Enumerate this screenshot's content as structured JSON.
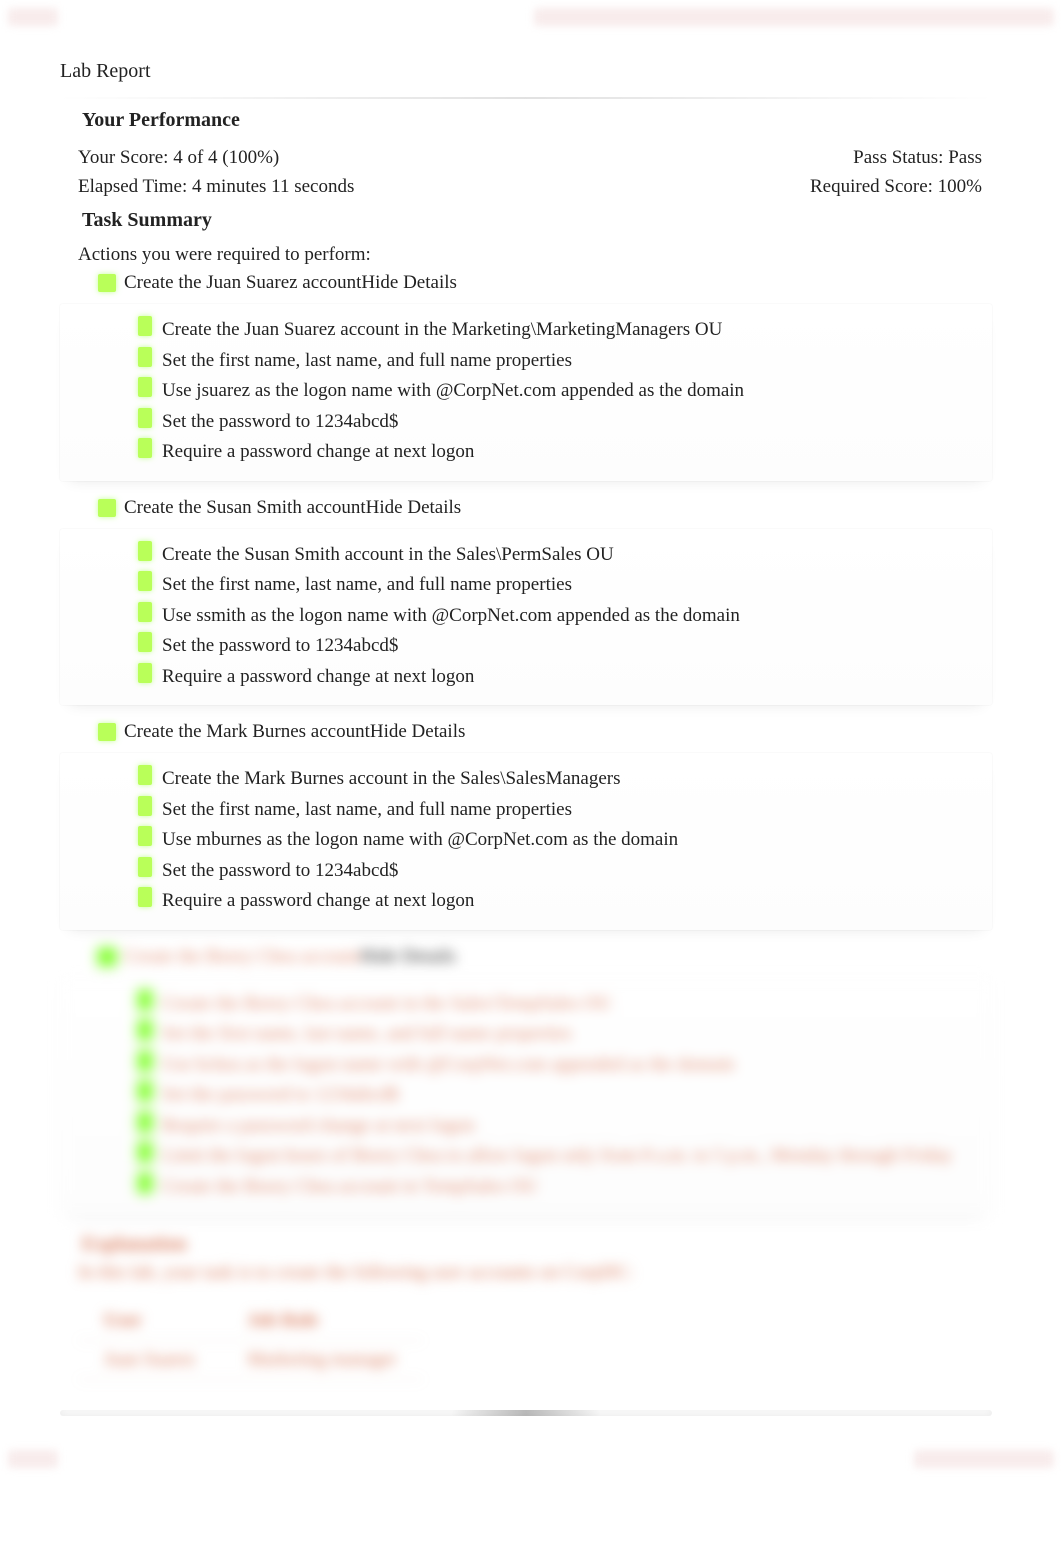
{
  "title": "Lab Report",
  "performance": {
    "heading": "Your Performance",
    "score_label": "Your Score: ",
    "score_value": "4 of 4 (100%)",
    "pass_label": "Pass Status: ",
    "pass_value": "Pass",
    "elapsed_label": "Elapsed Time: ",
    "elapsed_value": "4 minutes 11 seconds",
    "required_label": "Required Score: ",
    "required_value": "100%"
  },
  "task_summary": {
    "heading": "Task Summary",
    "intro": "Actions you were required to perform:",
    "hide_details": "Hide Details",
    "tasks": [
      {
        "title": "Create the Juan Suarez account",
        "details": [
          "Create the Juan Suarez account in the Marketing\\MarketingManagers OU",
          "Set the first name, last name, and full name properties",
          "Use jsuarez as the logon name with @CorpNet.com appended as the domain",
          "Set the password to 1234abcd$",
          "Require a password change at next logon"
        ]
      },
      {
        "title": "Create the Susan Smith account",
        "details": [
          "Create the Susan Smith account in the Sales\\PermSales OU",
          "Set the first name, last name, and full name properties",
          "Use ssmith as the logon name with @CorpNet.com appended as the domain",
          "Set the password to 1234abcd$",
          "Require a password change at next logon"
        ]
      },
      {
        "title": "Create the Mark Burnes account",
        "details": [
          "Create the Mark Burnes account in the Sales\\SalesManagers",
          "Set the first name, last name, and full name properties",
          "Use mburnes as the logon name with @CorpNet.com as the domain",
          "Set the password to 1234abcd$",
          "Require a password change at next logon"
        ]
      }
    ],
    "blurred_task": {
      "title": "Create the Borey Chea account",
      "details": [
        "Create the Borey Chea account in the Sales\\TempSales OU",
        "Set the first name, last name, and full name properties",
        "Use bchea as the logon name with @CorpNet.com appended as the domain",
        "Set the password to 1234abcd$",
        "Require a password change at next logon",
        "Limit the logon hours of Borey Chea to allow logon only from 8 a.m. to 5 p.m., Monday through Friday",
        "Create the Borey Chea account in TempSales OU"
      ]
    }
  },
  "explanation": {
    "heading": "Explanation",
    "intro": "In this lab, your task is to create the following user accounts on CorpDC:",
    "table": {
      "headers": [
        "User",
        "Job Role"
      ],
      "rows": [
        [
          "Juan Suarez",
          "Marketing manager"
        ]
      ]
    }
  }
}
